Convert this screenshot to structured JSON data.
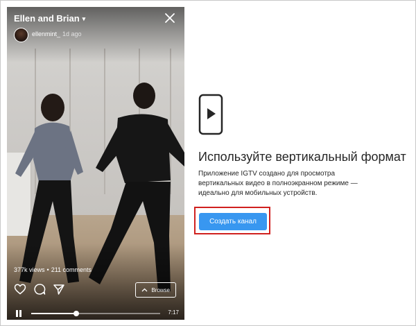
{
  "video": {
    "title": "Ellen and Brian",
    "title_chevron": "▾",
    "username": "ellenmint_",
    "posted_ago": "1d ago",
    "views": "377k views",
    "comments": "211 comments",
    "stats_separator": "•",
    "browse_label": "Browse",
    "duration": "7:17",
    "progress_fraction": 0.35
  },
  "promo": {
    "heading": "Используйте вертикальный формат",
    "description": "Приложение IGTV создано для просмотра вертикальных видео в полноэкранном режиме — идеально для мобильных устройств.",
    "button_label": "Создать канал"
  },
  "colors": {
    "accent": "#3897f0",
    "highlight": "#d0201e",
    "text": "#262626"
  },
  "icons": [
    "close-icon",
    "heart-icon",
    "comment-icon",
    "share-icon",
    "chevron-up-icon",
    "pause-icon",
    "phone-play-icon"
  ]
}
